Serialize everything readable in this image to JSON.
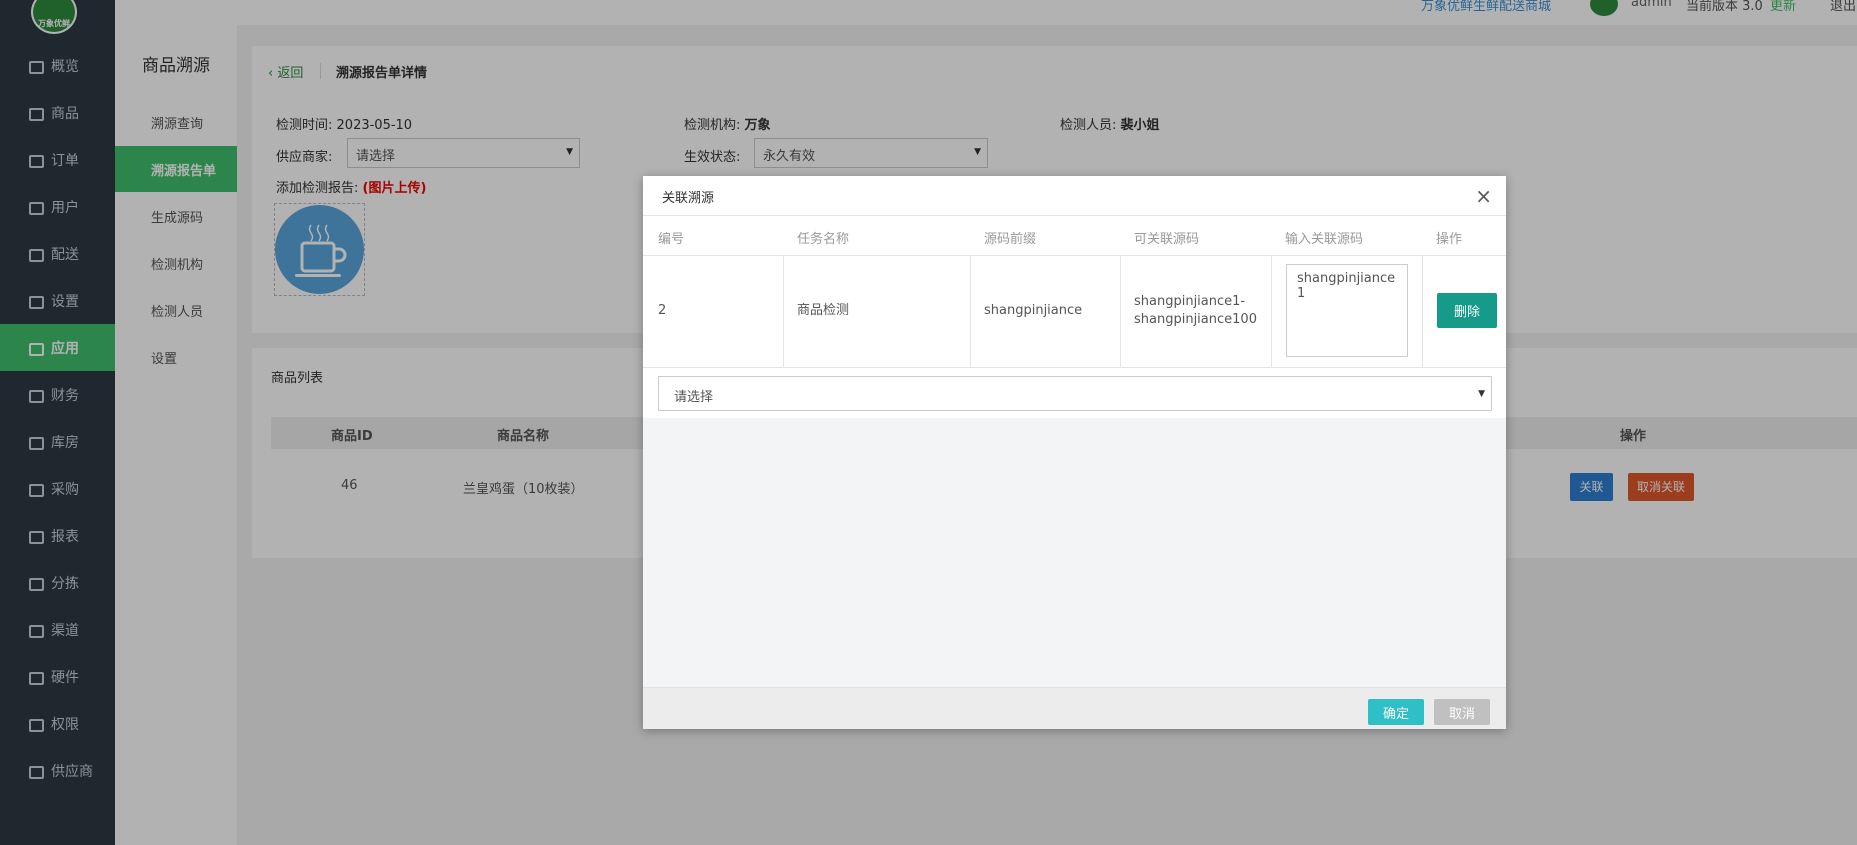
{
  "brand": {
    "logo_text": "万象优鲜",
    "color": "#2e8b3e"
  },
  "topbar": {
    "link": "万象优鲜生鲜配送商城",
    "user": "admin",
    "version": "当前版本 3.0",
    "update": "更新",
    "exit": "退出"
  },
  "sidebar": {
    "items": [
      {
        "label": "概览",
        "icon": "monitor-icon"
      },
      {
        "label": "商品",
        "icon": "cart-icon"
      },
      {
        "label": "订单",
        "icon": "money-icon"
      },
      {
        "label": "用户",
        "icon": "users-icon"
      },
      {
        "label": "配送",
        "icon": "truck-icon"
      },
      {
        "label": "设置",
        "icon": "puzzle-icon"
      },
      {
        "label": "应用",
        "icon": "apps-icon",
        "active": true
      },
      {
        "label": "财务",
        "icon": "yen-icon"
      },
      {
        "label": "库房",
        "icon": "home-icon"
      },
      {
        "label": "采购",
        "icon": "bus-icon"
      },
      {
        "label": "报表",
        "icon": "bar-chart-icon"
      },
      {
        "label": "分拣",
        "icon": "scale-icon"
      },
      {
        "label": "渠道",
        "icon": "cube-icon"
      },
      {
        "label": "硬件",
        "icon": "desktop-icon"
      },
      {
        "label": "权限",
        "icon": "bank-icon"
      },
      {
        "label": "供应商",
        "icon": "group-icon"
      }
    ]
  },
  "subnav": {
    "title": "商品溯源",
    "items": [
      {
        "label": "溯源查询"
      },
      {
        "label": "溯源报告单",
        "active": true
      },
      {
        "label": "生成源码"
      },
      {
        "label": "检测机构"
      },
      {
        "label": "检测人员"
      },
      {
        "label": "设置"
      }
    ]
  },
  "detail": {
    "back": "返回",
    "title": "溯源报告单详情",
    "test_time_label": "检测时间:",
    "test_time": "2023-05-10",
    "org_label": "检测机构:",
    "org": "万象",
    "person_label": "检测人员:",
    "person": "裴小姐",
    "supplier_label": "供应商家:",
    "supplier_value": "请选择",
    "status_label": "生效状态:",
    "status_value": "永久有效",
    "report_label": "添加检测报告:",
    "report_hint": "(图片上传)"
  },
  "product_list": {
    "title": "商品列表",
    "headers": [
      "商品ID",
      "商品名称",
      "操作"
    ],
    "rows": [
      {
        "id": "46",
        "name": "兰皇鸡蛋（10枚装）",
        "link": "关联",
        "unlink": "取消关联"
      }
    ]
  },
  "modal": {
    "title": "关联溯源",
    "close": "×",
    "headers": [
      "编号",
      "任务名称",
      "源码前缀",
      "可关联源码",
      "输入关联源码",
      "操作"
    ],
    "row": {
      "no": "2",
      "task": "商品检测",
      "prefix": "shangpinjiance",
      "range_start": "shangpinjiance1-",
      "range_end": "shangpinjiance100",
      "input_value": "shangpinjiance1",
      "delete": "删除"
    },
    "select_placeholder": "请选择",
    "ok": "确定",
    "cancel": "取消"
  }
}
